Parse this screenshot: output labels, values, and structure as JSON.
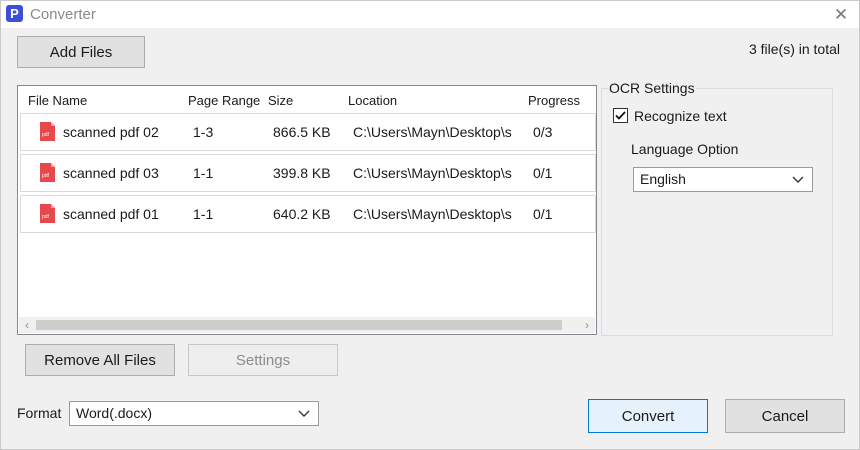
{
  "window": {
    "title": "Converter",
    "logo_letter": "P"
  },
  "toolbar": {
    "add_files_label": "Add Files",
    "file_count": "3 file(s) in total"
  },
  "file_list": {
    "columns": [
      "File Name",
      "Page Range",
      "Size",
      "Location",
      "Progress"
    ],
    "rows": [
      {
        "name": "scanned pdf 02",
        "range": "1-3",
        "size": "866.5 KB",
        "location": "C:\\Users\\Mayn\\Desktop\\s",
        "progress": "0/3",
        "icon_label": "pdf"
      },
      {
        "name": "scanned pdf 03",
        "range": "1-1",
        "size": "399.8 KB",
        "location": "C:\\Users\\Mayn\\Desktop\\s",
        "progress": "0/1",
        "icon_label": "pdf"
      },
      {
        "name": "scanned pdf 01",
        "range": "1-1",
        "size": "640.2 KB",
        "location": "C:\\Users\\Mayn\\Desktop\\s",
        "progress": "0/1",
        "icon_label": "pdf"
      }
    ]
  },
  "ocr": {
    "title": "OCR Settings",
    "recognize_label": "Recognize text",
    "recognize_checked": true,
    "language_label": "Language Option",
    "language_value": "English"
  },
  "actions": {
    "remove_all_label": "Remove All Files",
    "settings_label": "Settings",
    "format_label": "Format",
    "format_value": "Word(.docx)",
    "convert_label": "Convert",
    "cancel_label": "Cancel"
  },
  "icons": {
    "close": "close-icon",
    "file": "pdf-file-icon",
    "dropdown": "chevron-down-icon",
    "check": "checkmark-icon"
  },
  "colors": {
    "pdf_red": "#e8474c",
    "logo_blue": "#3d4fd6",
    "focus_blue": "#0078d7"
  }
}
